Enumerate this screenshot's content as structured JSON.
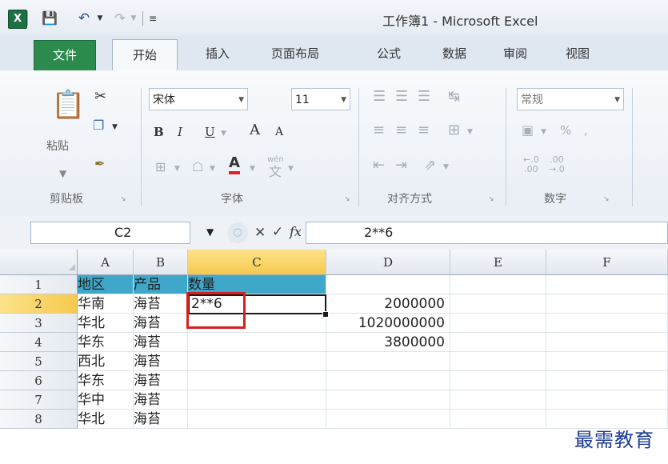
{
  "window": {
    "title": "工作簿1 - Microsoft Excel"
  },
  "quick_access": {
    "app_icon": "excel-icon",
    "save_icon": "save-icon",
    "undo_icon": "undo-icon",
    "redo_icon": "redo-icon",
    "customize_icon": "customize-icon"
  },
  "tabs": [
    {
      "label": "文件"
    },
    {
      "label": "开始"
    },
    {
      "label": "插入"
    },
    {
      "label": "页面布局"
    },
    {
      "label": "公式"
    },
    {
      "label": "数据"
    },
    {
      "label": "审阅"
    },
    {
      "label": "视图"
    }
  ],
  "ribbon": {
    "clipboard": {
      "paste_label": "粘贴",
      "group_label": "剪贴板"
    },
    "font": {
      "font_name": "宋体",
      "font_size": "11",
      "group_label": "字体",
      "bold": "B",
      "italic": "I",
      "underline": "U",
      "grow": "A",
      "shrink": "A",
      "font_color_letter": "A",
      "phonetic": "wén"
    },
    "alignment": {
      "group_label": "对齐方式"
    },
    "number": {
      "format": "常规",
      "percent": "%",
      "comma": ",",
      "group_label": "数字"
    }
  },
  "formula_bar": {
    "name_box": "C2",
    "formula": "2**6"
  },
  "grid": {
    "columns": [
      "A",
      "B",
      "C",
      "D",
      "E",
      "F"
    ],
    "rows": [
      "1",
      "2",
      "3",
      "4",
      "5",
      "6",
      "7",
      "8"
    ],
    "cells": {
      "A1": "地区",
      "B1": "产品",
      "C1": "数量",
      "A2": "华南",
      "B2": "海苔",
      "C2": "2**6",
      "D2": "2000000",
      "A3": "华北",
      "B3": "海苔",
      "D3": "1020000000",
      "A4": "华东",
      "B4": "海苔",
      "D4": "3800000",
      "A5": "西北",
      "B5": "海苔",
      "A6": "华东",
      "B6": "海苔",
      "A7": "华中",
      "B7": "海苔",
      "A8": "华北",
      "B8": "海苔"
    }
  },
  "watermark": "最需教育",
  "colors": {
    "file_tab": "#2c8a4c",
    "header_fill": "#3fa7c9",
    "highlight": "#d62020",
    "active_header": "#f6c94d"
  }
}
